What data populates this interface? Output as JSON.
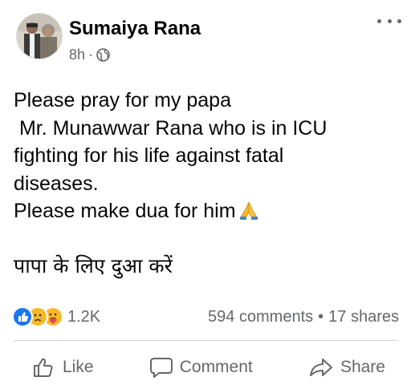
{
  "post": {
    "author": "Sumaiya Rana",
    "time": "8h",
    "separator": "·",
    "privacy_icon": "globe-icon",
    "lines": [
      "Please pray for my papa",
      " Mr. Munawwar Rana who is in ICU",
      "fighting for his life against fatal",
      "diseases."
    ],
    "last_english_line": "Please make dua for him",
    "last_line_emoji": "folded-hands-icon",
    "hindi_line": "पापा के लिए दुआ करें"
  },
  "stats": {
    "reaction_icons": [
      "like-reaction-icon",
      "sad-reaction-icon",
      "care-reaction-icon"
    ],
    "reaction_count": "1.2K",
    "comments": "594 comments",
    "dot": "•",
    "shares": "17 shares"
  },
  "actions": {
    "like": "Like",
    "comment": "Comment",
    "share": "Share"
  },
  "colors": {
    "text": "#050505",
    "secondary": "#65676b",
    "like_blue": "#1877f2",
    "reaction_yellow": "#f7b928",
    "divider": "#ced0d4"
  }
}
